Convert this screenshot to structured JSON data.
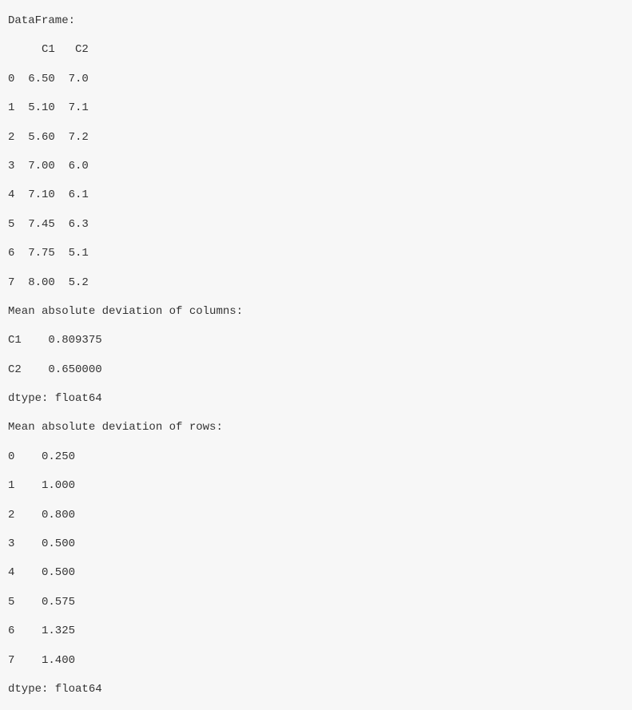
{
  "lines": {
    "l0": "DataFrame:",
    "l1": "     C1   C2",
    "l2": "0  6.50  7.0",
    "l3": "1  5.10  7.1",
    "l4": "2  5.60  7.2",
    "l5": "3  7.00  6.0",
    "l6": "4  7.10  6.1",
    "l7": "5  7.45  6.3",
    "l8": "6  7.75  5.1",
    "l9": "7  8.00  5.2",
    "l10": "Mean absolute deviation of columns:",
    "l11": "C1    0.809375",
    "l12": "C2    0.650000",
    "l13": "dtype: float64",
    "l14": "Mean absolute deviation of rows:",
    "l15": "0    0.250",
    "l16": "1    1.000",
    "l17": "2    0.800",
    "l18": "3    0.500",
    "l19": "4    0.500",
    "l20": "5    0.575",
    "l21": "6    1.325",
    "l22": "7    1.400",
    "l23": "dtype: float64"
  },
  "chart_data": {
    "type": "table",
    "dataframe": {
      "columns": [
        "C1",
        "C2"
      ],
      "index": [
        0,
        1,
        2,
        3,
        4,
        5,
        6,
        7
      ],
      "data": [
        [
          6.5,
          7.0
        ],
        [
          5.1,
          7.1
        ],
        [
          5.6,
          7.2
        ],
        [
          7.0,
          6.0
        ],
        [
          7.1,
          6.1
        ],
        [
          7.45,
          6.3
        ],
        [
          7.75,
          5.1
        ],
        [
          8.0,
          5.2
        ]
      ]
    },
    "mad_columns": {
      "C1": 0.809375,
      "C2": 0.65,
      "dtype": "float64"
    },
    "mad_rows": {
      "index": [
        0,
        1,
        2,
        3,
        4,
        5,
        6,
        7
      ],
      "values": [
        0.25,
        1.0,
        0.8,
        0.5,
        0.5,
        0.575,
        1.325,
        1.4
      ],
      "dtype": "float64"
    }
  }
}
